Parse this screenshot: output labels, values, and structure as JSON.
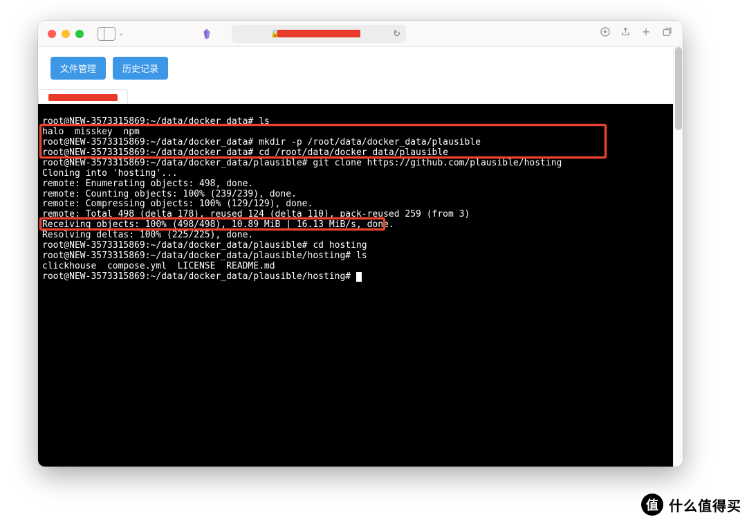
{
  "buttons": {
    "file_mgmt": "文件管理",
    "history": "历史记录"
  },
  "terminal": {
    "lines": [
      "root@NEW-3573315869:~/data/docker_data# ls",
      "halo  misskey  npm",
      "root@NEW-3573315869:~/data/docker_data# mkdir -p /root/data/docker_data/plausible",
      "root@NEW-3573315869:~/data/docker_data# cd /root/data/docker_data/plausible",
      "root@NEW-3573315869:~/data/docker_data/plausible# git clone https://github.com/plausible/hosting",
      "Cloning into 'hosting'...",
      "remote: Enumerating objects: 498, done.",
      "remote: Counting objects: 100% (239/239), done.",
      "remote: Compressing objects: 100% (129/129), done.",
      "remote: Total 498 (delta 178), reused 124 (delta 110), pack-reused 259 (from 3)",
      "Receiving objects: 100% (498/498), 10.89 MiB | 16.13 MiB/s, done.",
      "Resolving deltas: 100% (225/225), done.",
      "root@NEW-3573315869:~/data/docker_data/plausible# cd hosting",
      "root@NEW-3573315869:~/data/docker_data/plausible/hosting# ls",
      "clickhouse  compose.yml  LICENSE  README.md",
      "root@NEW-3573315869:~/data/docker_data/plausible/hosting# "
    ]
  },
  "watermark": {
    "badge": "值",
    "text": "什么值得买"
  }
}
